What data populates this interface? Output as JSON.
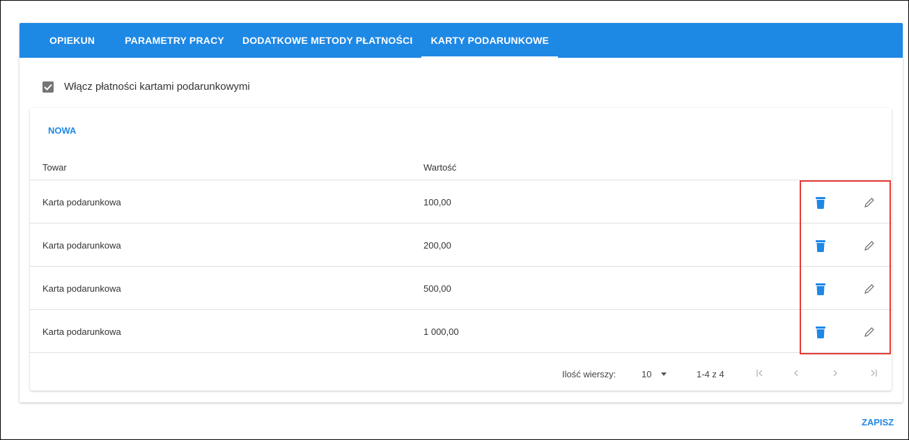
{
  "tabs": [
    {
      "label": "OPIEKUN",
      "active": false
    },
    {
      "label": "PARAMETRY PRACY",
      "active": false
    },
    {
      "label": "DODATKOWE METODY PŁATNOŚCI",
      "active": false
    },
    {
      "label": "KARTY PODARUNKOWE",
      "active": true
    }
  ],
  "enable_checkbox": {
    "label": "Włącz płatności kartami podarunkowymi",
    "checked": true
  },
  "new_button_label": "NOWA",
  "table": {
    "columns": [
      "Towar",
      "Wartość"
    ],
    "rows": [
      {
        "product": "Karta podarunkowa",
        "value": "100,00"
      },
      {
        "product": "Karta podarunkowa",
        "value": "200,00"
      },
      {
        "product": "Karta podarunkowa",
        "value": "500,00"
      },
      {
        "product": "Karta podarunkowa",
        "value": "1 000,00"
      }
    ],
    "row_actions": [
      "delete-icon",
      "edit-pencil-icon"
    ]
  },
  "pagination": {
    "rows_label": "Ilość wierszy:",
    "rows_per_page": "10",
    "range": "1-4 z 4",
    "buttons": [
      "first-page-icon",
      "prev-page-icon",
      "next-page-icon",
      "last-page-icon"
    ]
  },
  "save_button_label": "ZAPISZ",
  "colors": {
    "primary": "#1e88e5",
    "highlight": "#e53935",
    "checkbox": "#757575"
  }
}
